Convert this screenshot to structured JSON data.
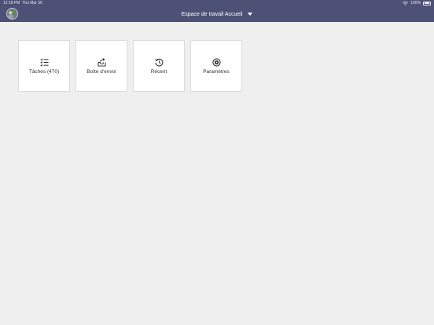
{
  "status_bar": {
    "time": "12:18 PM",
    "date": "Thu Mar 30",
    "battery": "100%"
  },
  "header": {
    "workspace_title": "Espace de travail Accueil",
    "workspace_caret_icon": "chevron-down-icon",
    "avatar_icon": "avatar"
  },
  "tiles": [
    {
      "label": "Tâches (470)",
      "icon": "task-list-icon"
    },
    {
      "label": "Boîte d'envoi",
      "icon": "outbox-icon"
    },
    {
      "label": "Récent",
      "icon": "history-icon"
    },
    {
      "label": "Paramètres",
      "icon": "settings-icon"
    }
  ],
  "colors": {
    "header_bg": "#4d5175",
    "page_bg": "#efefef",
    "tile_bg": "#ffffff"
  }
}
